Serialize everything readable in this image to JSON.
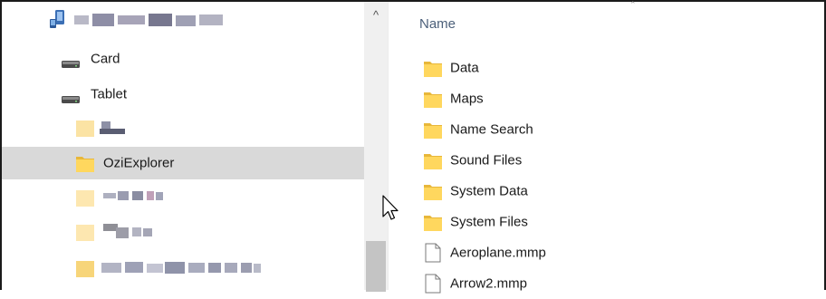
{
  "navigation": {
    "device_name": "",
    "items": [
      {
        "label": "Card",
        "icon": "drive-icon"
      },
      {
        "label": "Tablet",
        "icon": "drive-icon"
      },
      {
        "label": "OziExplorer",
        "icon": "folder-icon",
        "selected": true
      }
    ]
  },
  "scrollbar": {
    "up_arrow": "^"
  },
  "content": {
    "column_header": "Name",
    "folders": [
      "Data",
      "Maps",
      "Name Search",
      "Sound Files",
      "System Data",
      "System Files"
    ],
    "files": [
      "Aeroplane.mmp",
      "Arrow2.mmp"
    ]
  },
  "colors": {
    "folder_fill": "#ffd75e",
    "folder_shade": "#e8b73a",
    "selection": "#d9d9d9",
    "header_text": "#4c607a"
  }
}
